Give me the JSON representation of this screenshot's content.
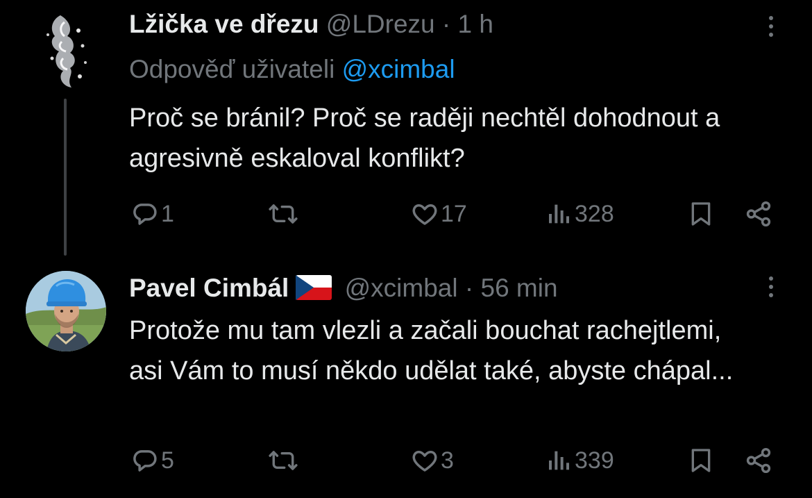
{
  "tweets": [
    {
      "display_name": "Lžička ve dřezu",
      "handle": "@LDrezu",
      "separator": "·",
      "time": "1 h",
      "reply_prefix": "Odpověď uživateli",
      "reply_mention": "@xcimbal",
      "text": "Proč se bránil? Proč se raději nechtěl dohodnout a agresivně eskaloval konflikt?",
      "replies": "1",
      "retweets": "",
      "likes": "17",
      "views": "328"
    },
    {
      "display_name": "Pavel Cimbál",
      "flag": "czech-flag-emoji",
      "handle": "@xcimbal",
      "separator": "·",
      "time": "56 min",
      "text": "Protože mu tam vlezli a začali bouchat rachejtlemi, asi Vám to musí někdo udělat také, abyste chápal...",
      "replies": "5",
      "retweets": "",
      "likes": "3",
      "views": "339"
    }
  ],
  "colors": {
    "background": "#000000",
    "text_primary": "#e7e9ea",
    "text_secondary": "#71767b",
    "link": "#1d9bf0",
    "thread_line": "#3e4144"
  },
  "icons": [
    "reply-icon",
    "retweet-icon",
    "like-icon",
    "views-icon",
    "bookmark-icon",
    "share-icon",
    "more-options-icon"
  ]
}
